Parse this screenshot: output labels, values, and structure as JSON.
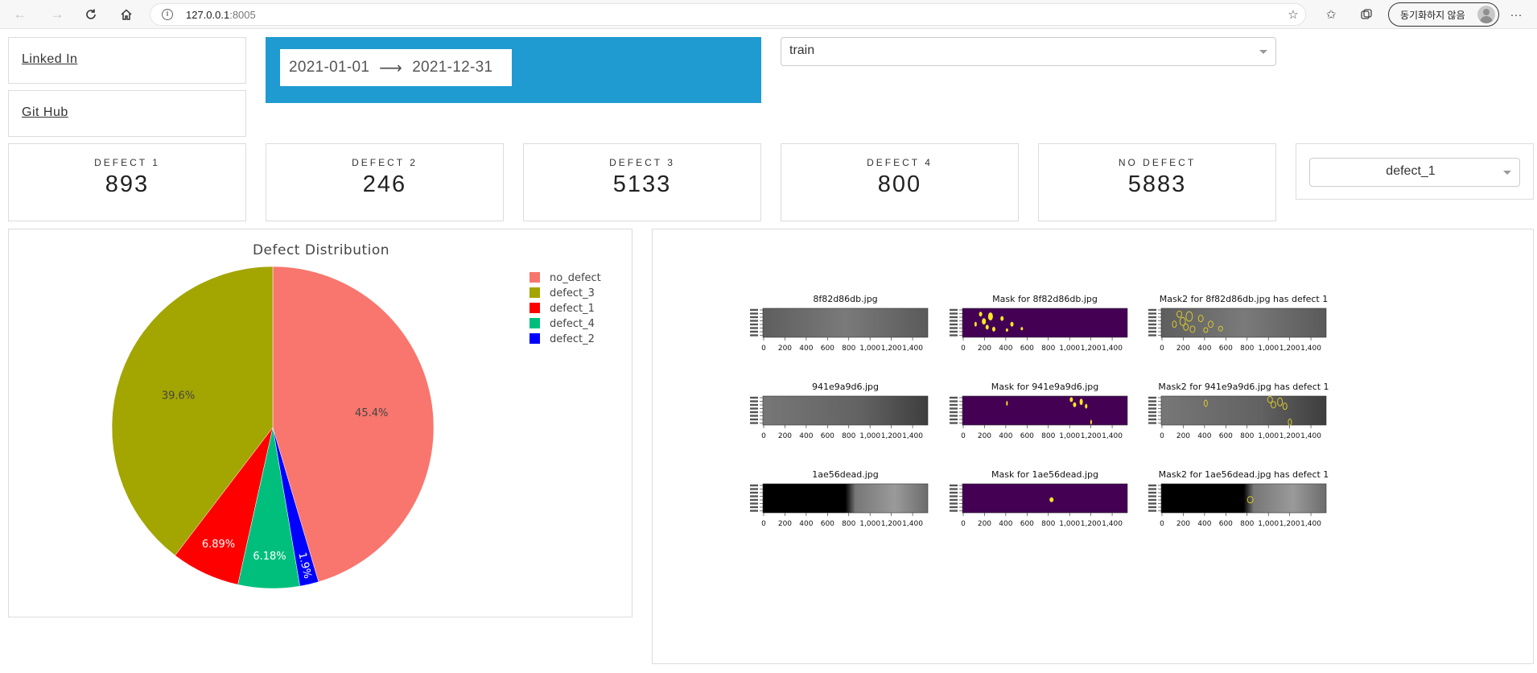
{
  "browser": {
    "url_host": "127.0.0.1",
    "url_port": ":8005",
    "profile_label": "동기화하지 않음"
  },
  "links": {
    "linkedin": "Linked In",
    "github": "Git Hub"
  },
  "date_range": {
    "start": "2021-01-01",
    "arrow": "⟶",
    "end": "2021-12-31"
  },
  "dataset_select": {
    "value": "train"
  },
  "kpis": [
    {
      "label": "DEFECT 1",
      "value": "893"
    },
    {
      "label": "DEFECT 2",
      "value": "246"
    },
    {
      "label": "DEFECT 3",
      "value": "5133"
    },
    {
      "label": "DEFECT 4",
      "value": "800"
    },
    {
      "label": "NO DEFECT",
      "value": "5883"
    }
  ],
  "defect_select": {
    "value": "defect_1"
  },
  "colors": {
    "accent_blue": "#1f9bd1",
    "no_defect": "#f8766d",
    "defect_3": "#a3a500",
    "defect_1": "#ff0000",
    "defect_4": "#00bf7d",
    "defect_2": "#0000ff",
    "mask_bg": "#440154",
    "mask_spot": "#fde725"
  },
  "chart_data": {
    "type": "pie",
    "title": "Defect Distribution",
    "slices": [
      {
        "label": "no_defect",
        "value": 5883,
        "percent_label": "45.4%",
        "color": "#f8766d"
      },
      {
        "label": "defect_2",
        "value": 246,
        "percent_label": "1.9%",
        "color": "#0000ff"
      },
      {
        "label": "defect_4",
        "value": 800,
        "percent_label": "6.18%",
        "color": "#00bf7d"
      },
      {
        "label": "defect_1",
        "value": 893,
        "percent_label": "6.89%",
        "color": "#ff0000"
      },
      {
        "label": "defect_3",
        "value": 5133,
        "percent_label": "39.6%",
        "color": "#a3a500"
      }
    ],
    "legend": [
      "no_defect",
      "defect_3",
      "defect_1",
      "defect_4",
      "defect_2"
    ],
    "legend_position": "top-right"
  },
  "image_grid": {
    "x_ticks": [
      "0",
      "200",
      "400",
      "600",
      "800",
      "1,000",
      "1,200",
      "1,400"
    ],
    "rows": [
      {
        "titles": [
          "8f82d86db.jpg",
          "Mask for 8f82d86db.jpg",
          "Mask2 for 8f82d86db.jpg has defect 1"
        ]
      },
      {
        "titles": [
          "941e9a9d6.jpg",
          "Mask for 941e9a9d6.jpg",
          "Mask2 for 941e9a9d6.jpg has defect 1"
        ]
      },
      {
        "titles": [
          "1ae56dead.jpg",
          "Mask for 1ae56dead.jpg",
          "Mask2 for 1ae56dead.jpg has defect 1"
        ]
      }
    ]
  }
}
